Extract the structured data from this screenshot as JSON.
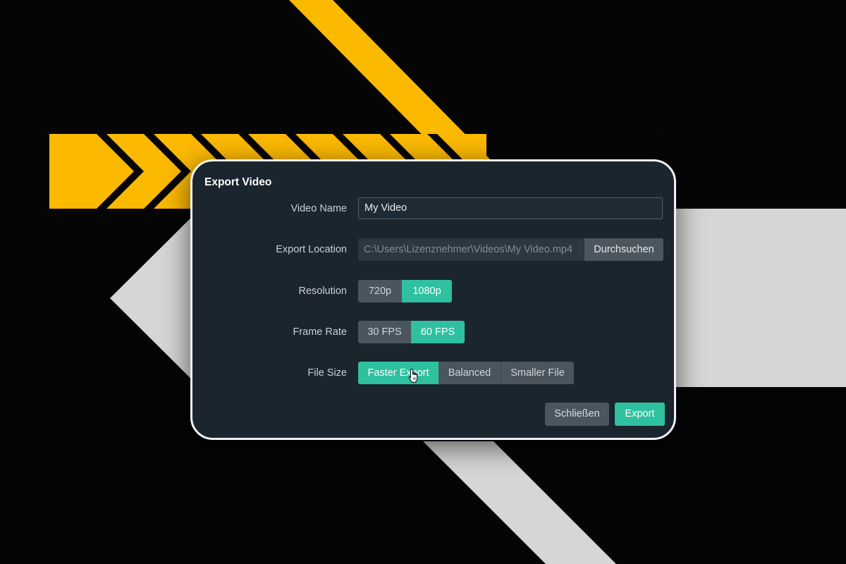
{
  "dialog": {
    "title": "Export Video",
    "video_name": {
      "label": "Video Name",
      "value": "My Video"
    },
    "export_location": {
      "label": "Export Location",
      "path": "C:\\Users\\Lizenznehmer\\Videos\\My Video.mp4",
      "browse_label": "Durchsuchen"
    },
    "resolution": {
      "label": "Resolution",
      "options": [
        "720p",
        "1080p"
      ],
      "selected": "1080p"
    },
    "frame_rate": {
      "label": "Frame Rate",
      "options": [
        "30 FPS",
        "60 FPS"
      ],
      "selected": "60 FPS"
    },
    "file_size": {
      "label": "File Size",
      "options": [
        "Faster Export",
        "Balanced",
        "Smaller File"
      ],
      "selected": "Faster Export"
    },
    "close_label": "Schließen",
    "export_label": "Export"
  },
  "colors": {
    "accent": "#2fc0a0",
    "dialog_background": "#1b252e",
    "stripe_yellow": "#fbb900",
    "stripe_light": "#d6d6d4"
  },
  "icons": [
    "hand-pointer-cursor-icon"
  ]
}
